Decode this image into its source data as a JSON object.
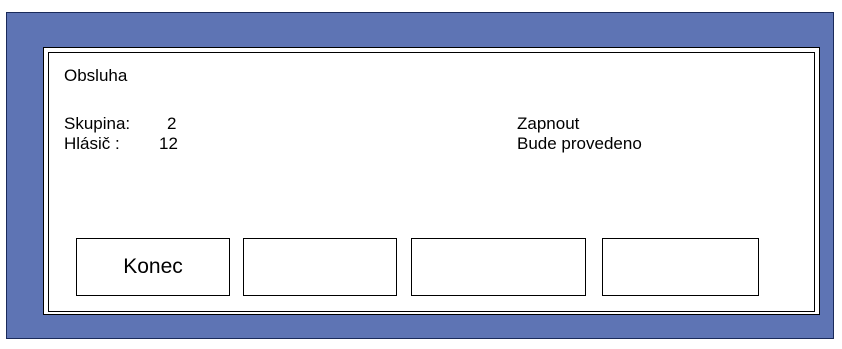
{
  "panel": {
    "title": "Obsluha",
    "group_label": "Skupina:",
    "group_value": "2",
    "detector_label": "Hlásič :",
    "detector_value": "12",
    "action": "Zapnout",
    "status": "Bude provedeno"
  },
  "buttons": [
    {
      "label": "Konec"
    },
    {
      "label": ""
    },
    {
      "label": ""
    },
    {
      "label": ""
    }
  ],
  "colors": {
    "background": "#5e74b4",
    "panel": "#ffffff"
  }
}
